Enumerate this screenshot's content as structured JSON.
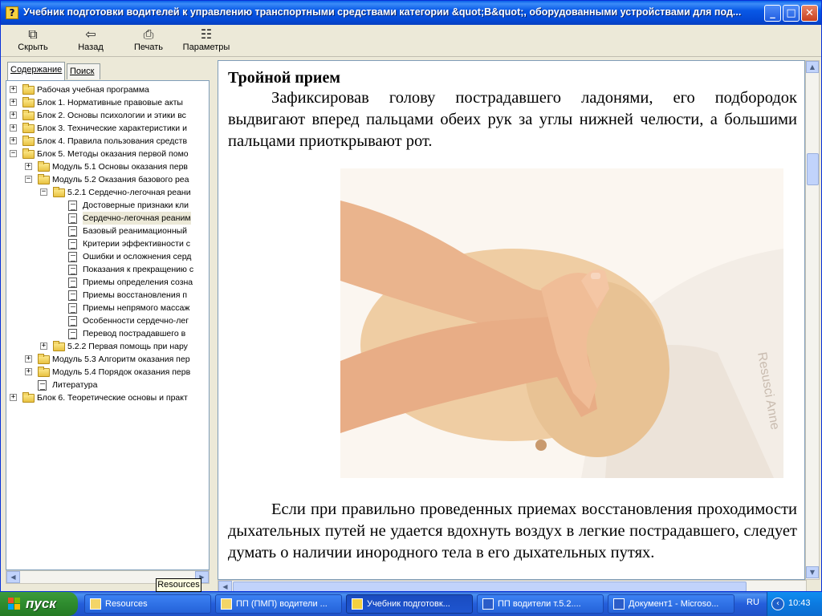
{
  "window": {
    "title": "Учебник подготовки водителей к управлению транспортными средствами категории &quot;B&quot;, оборудованными устройствами для под...",
    "icon_label": "?",
    "minimize_icon": "_",
    "maximize_icon": "□",
    "close_icon": "✕"
  },
  "toolbar": {
    "hide": {
      "label": "Скрыть",
      "icon": "⧉"
    },
    "back": {
      "label": "Назад",
      "icon": "⇦"
    },
    "print": {
      "label": "Печать",
      "icon": "⎙"
    },
    "options": {
      "label": "Параметры",
      "icon": "☷"
    }
  },
  "tabs": {
    "contents": "Содержание",
    "search": "Поиск"
  },
  "tree": [
    {
      "label": "Рабочая учебная программа",
      "kind": "folder",
      "level": 0,
      "expander": "+"
    },
    {
      "label": "Блок 1. Нормативные правовые акты",
      "kind": "folder",
      "level": 0,
      "expander": "+"
    },
    {
      "label": "Блок 2. Основы психологии и этики вс",
      "kind": "folder",
      "level": 0,
      "expander": "+"
    },
    {
      "label": "Блок 3. Технические характеристики и",
      "kind": "folder",
      "level": 0,
      "expander": "+"
    },
    {
      "label": "Блок 4. Правила пользования средств",
      "kind": "folder",
      "level": 0,
      "expander": "+"
    },
    {
      "label": "Блок 5. Методы оказания первой помо",
      "kind": "folder",
      "level": 0,
      "expander": "−"
    },
    {
      "label": "Модуль 5.1 Основы оказания перв",
      "kind": "folder",
      "level": 1,
      "expander": "+"
    },
    {
      "label": "Модуль 5.2 Оказания базового реа",
      "kind": "folder",
      "level": 1,
      "expander": "−"
    },
    {
      "label": "5.2.1 Сердечно-легочная реани",
      "kind": "folder",
      "level": 2,
      "expander": "−"
    },
    {
      "label": "Достоверные признаки кли",
      "kind": "page",
      "level": 3,
      "expander": ""
    },
    {
      "label": "Сердечно-легочная реаним",
      "kind": "page",
      "level": 3,
      "expander": "",
      "selected": true
    },
    {
      "label": "Базовый реанимационный",
      "kind": "page",
      "level": 3,
      "expander": ""
    },
    {
      "label": "Критерии эффективности с",
      "kind": "page",
      "level": 3,
      "expander": ""
    },
    {
      "label": "Ошибки и осложнения серд",
      "kind": "page",
      "level": 3,
      "expander": ""
    },
    {
      "label": "Показания к прекращению с",
      "kind": "page",
      "level": 3,
      "expander": ""
    },
    {
      "label": "Приемы определения созна",
      "kind": "page",
      "level": 3,
      "expander": ""
    },
    {
      "label": "Приемы восстановления п",
      "kind": "page",
      "level": 3,
      "expander": ""
    },
    {
      "label": "Приемы непрямого массаж",
      "kind": "page",
      "level": 3,
      "expander": ""
    },
    {
      "label": "Особенности сердечно-лег",
      "kind": "page",
      "level": 3,
      "expander": ""
    },
    {
      "label": "Перевод пострадавшего в",
      "kind": "page",
      "level": 3,
      "expander": ""
    },
    {
      "label": "5.2.2 Первая помощь при нару",
      "kind": "folder",
      "level": 2,
      "expander": "+"
    },
    {
      "label": "Модуль 5.3 Алгоритм оказания пер",
      "kind": "folder",
      "level": 1,
      "expander": "+"
    },
    {
      "label": "Модуль 5.4 Порядок оказания перв",
      "kind": "folder",
      "level": 1,
      "expander": "+"
    },
    {
      "label": "Литература",
      "kind": "page",
      "level": 1,
      "expander": ""
    },
    {
      "label": "Блок 6. Теоретические основы и практ",
      "kind": "folder",
      "level": 0,
      "expander": "+"
    }
  ],
  "tooltip": "Resources",
  "content": {
    "heading": "Тройной прием",
    "para1": "Зафиксировав голову пострадавшего ладонями, его подбородок выдвигают вперед пальцами обеих рук за углы нижней челюсти, а большими пальцами приоткрывают рот.",
    "para2": "Если при правильно проведенных приемах восстановления проходимости дыхательных путей не удается вдохнуть воздух в легкие пострадавшего, следует думать о наличии инородного тела в его дыхательных путях.",
    "photo_text": "Resusci Anne"
  },
  "scroll": {
    "up": "▲",
    "down": "▼",
    "left": "◀",
    "right": "▶"
  },
  "taskbar": {
    "start": "пуск",
    "tasks": [
      {
        "label": "Resources",
        "icon": "folder-icon"
      },
      {
        "label": "ПП (ПМП) водители ...",
        "icon": "folder-icon"
      },
      {
        "label": "Учебник подготовк...",
        "icon": "help-icon",
        "active": true
      },
      {
        "label": "ПП водители т.5.2....",
        "icon": "word-icon"
      },
      {
        "label": "Документ1 - Microso...",
        "icon": "word-icon"
      }
    ],
    "lang": "RU",
    "tray_icon": "‹",
    "clock": "10:43"
  },
  "colors": {
    "titlebar": "#0a5fe8",
    "taskbar": "#245edb",
    "start": "#2e8b2e",
    "selection": "#ece9d8"
  }
}
